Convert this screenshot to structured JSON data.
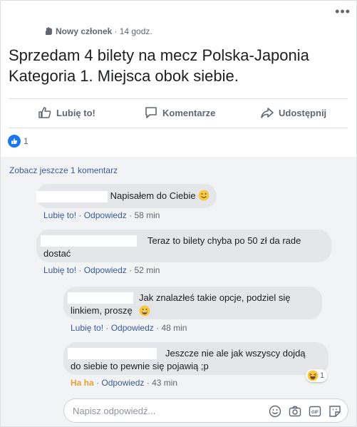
{
  "post": {
    "author_role": "Nowy członek",
    "time": "· 14 godz.",
    "text": "Sprzedam 4 bilety na mecz Polska-Japonia Kategoria 1. Miejsca obok siebie."
  },
  "actions": {
    "like": "Lubię to!",
    "comment": "Komentarze",
    "share": "Udostępnij"
  },
  "reactions": {
    "count": "1"
  },
  "comments": {
    "see_more": "Zobacz jeszcze 1 komentarz",
    "items": [
      {
        "text": "Napisałem do Ciebie",
        "like": "Lubię to!",
        "reply": "Odpowiedz",
        "time": "58 min"
      },
      {
        "text_line1": "Teraz to bilety chyba po 50 zł da rade",
        "text_line2": "dostać",
        "like": "Lubię to!",
        "reply": "Odpowiedz",
        "time": "52 min"
      },
      {
        "text_line1": "Jak znalazłeś takie opcje, podziel się",
        "text_line2": "linkiem, proszę",
        "like": "Lubię to!",
        "reply": "Odpowiedz",
        "time": "48 min"
      },
      {
        "text_line1": "Jeszcze nie ale jak wszyscy dojdą",
        "text_line2": "do siebie to pewnie się pojawią ;p",
        "reaction": "Ha ha",
        "reply": "Odpowiedz",
        "time": "43 min",
        "reaction_count": "1"
      }
    ]
  },
  "reply_box": {
    "placeholder": "Napisz odpowiedź..."
  },
  "colors": {
    "link": "#385898",
    "meta": "#606770",
    "bubble": "#e4e6e9",
    "like_blue": "#1877f2",
    "haha": "#e8a13a"
  }
}
